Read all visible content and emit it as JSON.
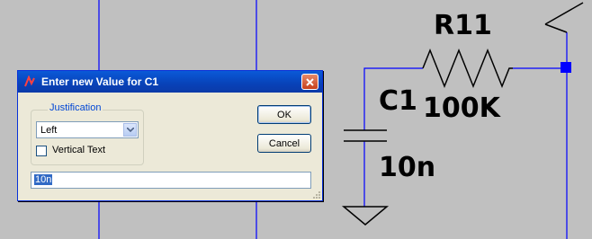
{
  "schematic": {
    "resistor": {
      "ref": "R11",
      "value": "100K"
    },
    "capacitor": {
      "ref": "C1",
      "value": "10n"
    },
    "colors": {
      "wire": "#0000ff",
      "component": "#000000",
      "background": "#c0c0c0"
    }
  },
  "dialog": {
    "title": "Enter new Value for C1",
    "icon": "ltspice-icon",
    "close_icon": "close-icon",
    "justification": {
      "group_label": "Justification",
      "selected": "Left"
    },
    "vertical_text": {
      "label": "Vertical Text",
      "checked": false
    },
    "ok_label": "OK",
    "cancel_label": "Cancel",
    "value_input": {
      "value": "10n"
    }
  }
}
